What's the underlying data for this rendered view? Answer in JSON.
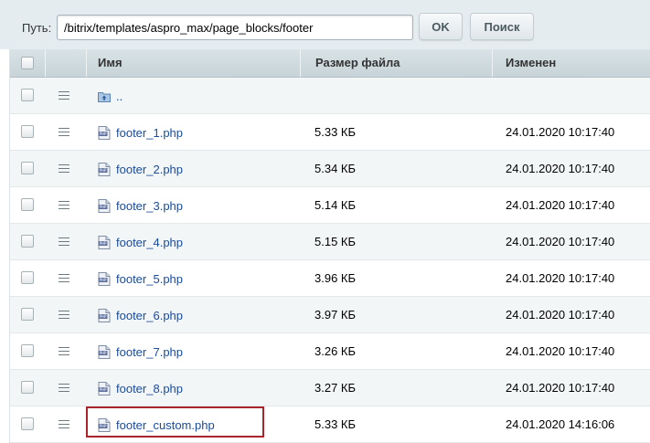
{
  "path": {
    "label": "Путь:",
    "value": "/bitrix/templates/aspro_max/page_blocks/footer"
  },
  "buttons": {
    "ok": "OK",
    "search": "Поиск"
  },
  "columns": {
    "name": "Имя",
    "size": "Размер файла",
    "modified": "Изменен"
  },
  "rows": [
    {
      "name": "..",
      "size": "",
      "modified": "",
      "icon": "folder-up-icon"
    },
    {
      "name": "footer_1.php",
      "size": "5.33 КБ",
      "modified": "24.01.2020 10:17:40",
      "icon": "php-file-icon"
    },
    {
      "name": "footer_2.php",
      "size": "5.34 КБ",
      "modified": "24.01.2020 10:17:40",
      "icon": "php-file-icon"
    },
    {
      "name": "footer_3.php",
      "size": "5.14 КБ",
      "modified": "24.01.2020 10:17:40",
      "icon": "php-file-icon"
    },
    {
      "name": "footer_4.php",
      "size": "5.15 КБ",
      "modified": "24.01.2020 10:17:40",
      "icon": "php-file-icon"
    },
    {
      "name": "footer_5.php",
      "size": "3.96 КБ",
      "modified": "24.01.2020 10:17:40",
      "icon": "php-file-icon"
    },
    {
      "name": "footer_6.php",
      "size": "3.97 КБ",
      "modified": "24.01.2020 10:17:40",
      "icon": "php-file-icon"
    },
    {
      "name": "footer_7.php",
      "size": "3.26 КБ",
      "modified": "24.01.2020 10:17:40",
      "icon": "php-file-icon"
    },
    {
      "name": "footer_8.php",
      "size": "3.27 КБ",
      "modified": "24.01.2020 10:17:40",
      "icon": "php-file-icon"
    },
    {
      "name": "footer_custom.php",
      "size": "5.33 КБ",
      "modified": "24.01.2020 14:16:06",
      "icon": "php-file-icon",
      "highlighted": true
    }
  ],
  "colors": {
    "highlight_border": "#a9252b",
    "link": "#1a4b9a",
    "header_bg": "#c7d3d8"
  }
}
